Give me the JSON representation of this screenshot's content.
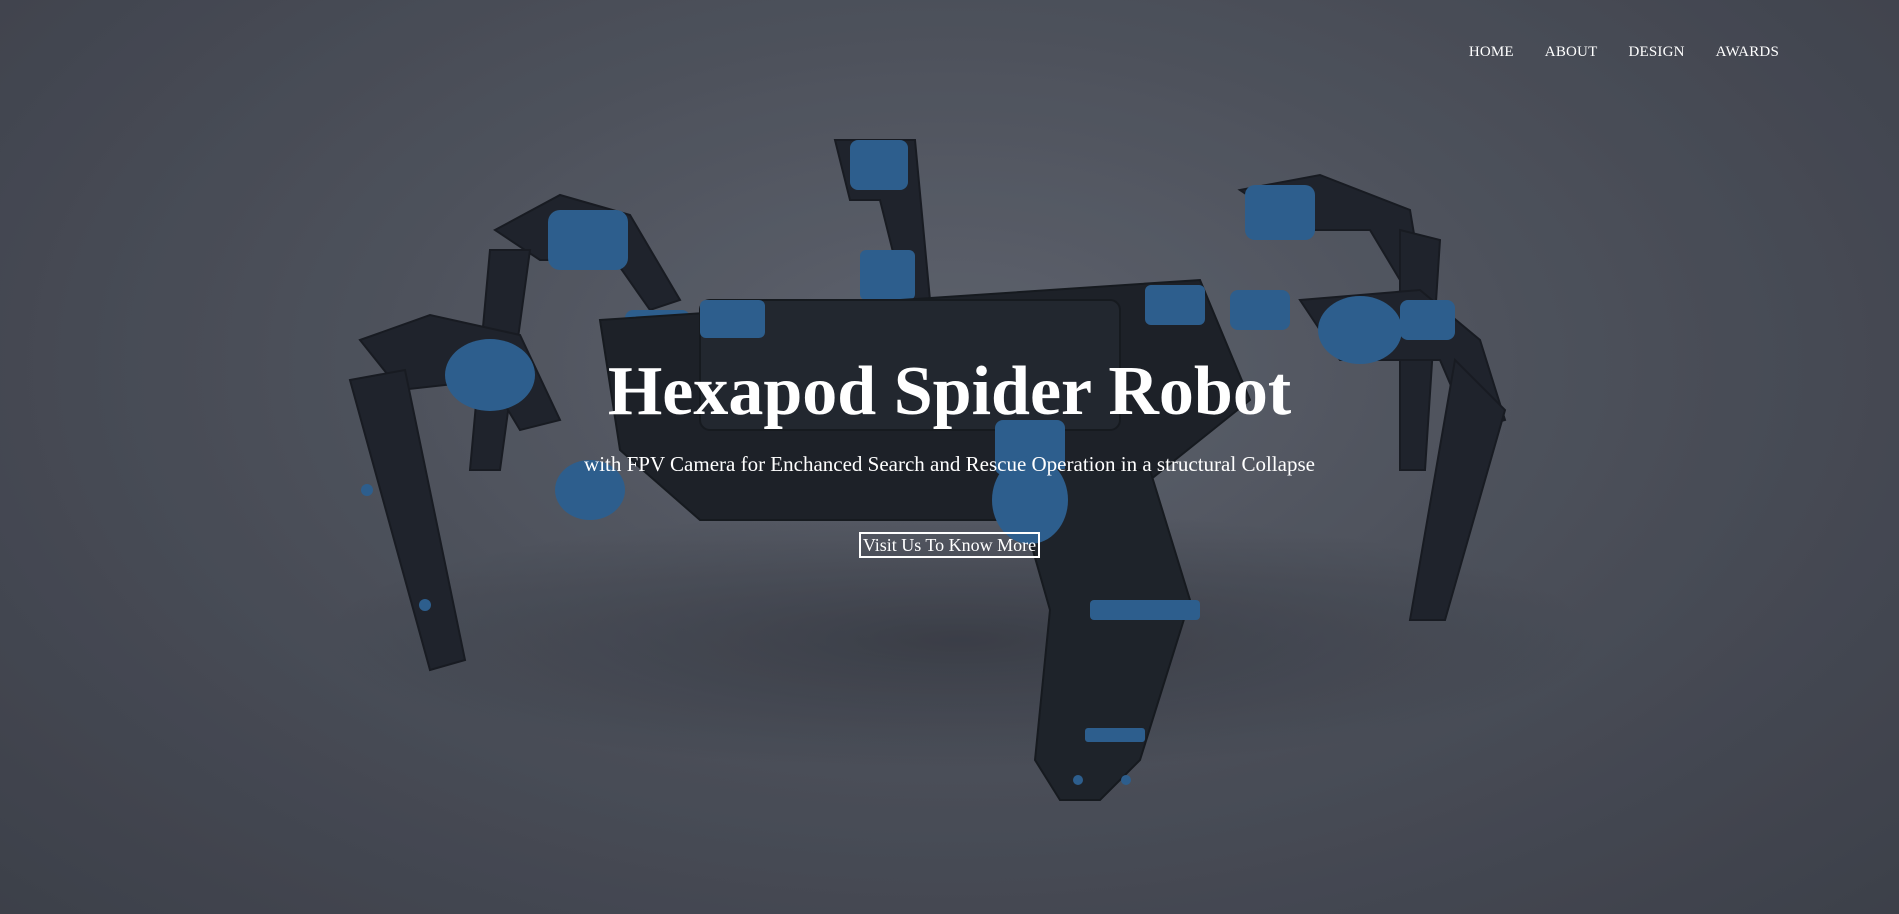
{
  "nav": {
    "items": [
      {
        "label": "HOME"
      },
      {
        "label": "ABOUT"
      },
      {
        "label": "DESIGN"
      },
      {
        "label": "AWARDS"
      }
    ]
  },
  "hero": {
    "title": "Hexapod Spider Robot",
    "subtitle": "with FPV Camera for Enchanced Search and Rescue Operation in a structural Collapse",
    "cta_label": "Visit Us To Know More"
  },
  "colors": {
    "background": "#555964",
    "robot_frame": "#1f232d",
    "robot_accent": "#2f6aa1",
    "text": "#ffffff"
  }
}
